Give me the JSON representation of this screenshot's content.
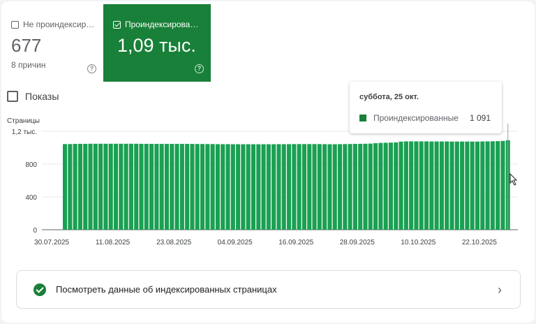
{
  "tiles": [
    {
      "label": "Не проиндексир…",
      "value": "677",
      "sub": "8 причин",
      "checked": false
    },
    {
      "label": "Проиндексирова…",
      "value": "1,09 тыс.",
      "sub": "",
      "checked": true
    }
  ],
  "help_glyph": "?",
  "toggle": {
    "label": "Показы"
  },
  "colors": {
    "accent": "#188038",
    "bar": "#1aa052"
  },
  "chart_data": {
    "type": "bar",
    "ylabel": "Страницы",
    "ylim": [
      0,
      1200
    ],
    "yticks": [
      "0",
      "400",
      "800",
      "1,2 тыс."
    ],
    "ytick_values": [
      0,
      400,
      800,
      1200
    ],
    "xtick_labels": [
      "30.07.2025",
      "11.08.2025",
      "23.08.2025",
      "04.09.2025",
      "16.09.2025",
      "28.09.2025",
      "10.10.2025",
      "22.10.2025"
    ],
    "xtick_index": [
      0,
      12,
      24,
      36,
      48,
      60,
      72,
      84
    ],
    "series": [
      {
        "name": "Проиндексированные",
        "values": [
          1044,
          1044,
          1046,
          1047,
          1047,
          1048,
          1048,
          1048,
          1048,
          1048,
          1048,
          1048,
          1048,
          1048,
          1048,
          1047,
          1047,
          1047,
          1046,
          1046,
          1046,
          1046,
          1046,
          1046,
          1046,
          1046,
          1045,
          1045,
          1044,
          1044,
          1043,
          1043,
          1043,
          1042,
          1042,
          1042,
          1042,
          1042,
          1042,
          1042,
          1042,
          1042,
          1043,
          1043,
          1043,
          1044,
          1044,
          1044,
          1044,
          1044,
          1044,
          1043,
          1042,
          1042,
          1043,
          1044,
          1045,
          1046,
          1047,
          1048,
          1050,
          1055,
          1058,
          1060,
          1062,
          1064,
          1074,
          1077,
          1077,
          1077,
          1077,
          1077,
          1076,
          1076,
          1076,
          1076,
          1075,
          1075,
          1075,
          1075,
          1075,
          1075,
          1076,
          1077,
          1078,
          1080,
          1082,
          1091
        ]
      }
    ]
  },
  "tooltip": {
    "date": "суббота, 25 окт.",
    "series": "Проиндексированные",
    "value": "1 091"
  },
  "link": {
    "label": "Посмотреть данные об индексированных страницах"
  }
}
